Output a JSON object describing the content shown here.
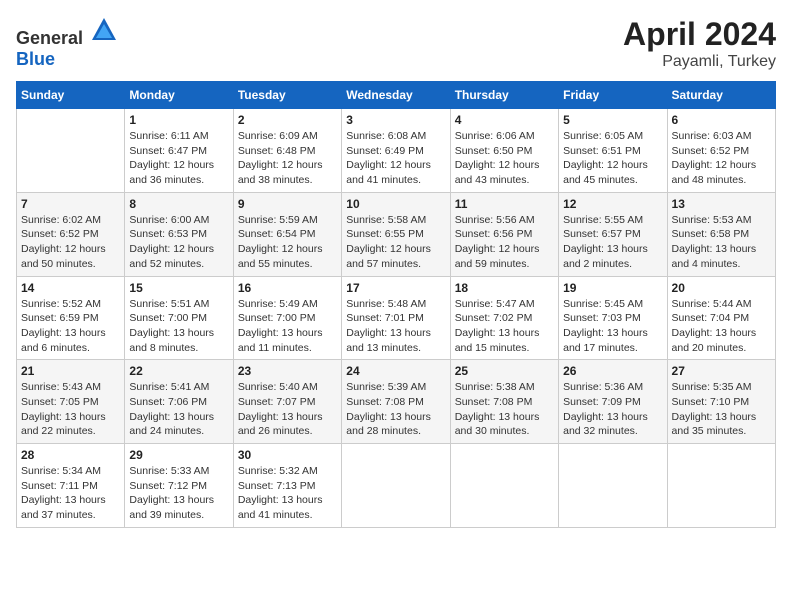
{
  "header": {
    "logo_general": "General",
    "logo_blue": "Blue",
    "title": "April 2024",
    "location": "Payamli, Turkey"
  },
  "days_of_week": [
    "Sunday",
    "Monday",
    "Tuesday",
    "Wednesday",
    "Thursday",
    "Friday",
    "Saturday"
  ],
  "weeks": [
    [
      {
        "day": "",
        "info": ""
      },
      {
        "day": "1",
        "info": "Sunrise: 6:11 AM\nSunset: 6:47 PM\nDaylight: 12 hours\nand 36 minutes."
      },
      {
        "day": "2",
        "info": "Sunrise: 6:09 AM\nSunset: 6:48 PM\nDaylight: 12 hours\nand 38 minutes."
      },
      {
        "day": "3",
        "info": "Sunrise: 6:08 AM\nSunset: 6:49 PM\nDaylight: 12 hours\nand 41 minutes."
      },
      {
        "day": "4",
        "info": "Sunrise: 6:06 AM\nSunset: 6:50 PM\nDaylight: 12 hours\nand 43 minutes."
      },
      {
        "day": "5",
        "info": "Sunrise: 6:05 AM\nSunset: 6:51 PM\nDaylight: 12 hours\nand 45 minutes."
      },
      {
        "day": "6",
        "info": "Sunrise: 6:03 AM\nSunset: 6:52 PM\nDaylight: 12 hours\nand 48 minutes."
      }
    ],
    [
      {
        "day": "7",
        "info": "Sunrise: 6:02 AM\nSunset: 6:52 PM\nDaylight: 12 hours\nand 50 minutes."
      },
      {
        "day": "8",
        "info": "Sunrise: 6:00 AM\nSunset: 6:53 PM\nDaylight: 12 hours\nand 52 minutes."
      },
      {
        "day": "9",
        "info": "Sunrise: 5:59 AM\nSunset: 6:54 PM\nDaylight: 12 hours\nand 55 minutes."
      },
      {
        "day": "10",
        "info": "Sunrise: 5:58 AM\nSunset: 6:55 PM\nDaylight: 12 hours\nand 57 minutes."
      },
      {
        "day": "11",
        "info": "Sunrise: 5:56 AM\nSunset: 6:56 PM\nDaylight: 12 hours\nand 59 minutes."
      },
      {
        "day": "12",
        "info": "Sunrise: 5:55 AM\nSunset: 6:57 PM\nDaylight: 13 hours\nand 2 minutes."
      },
      {
        "day": "13",
        "info": "Sunrise: 5:53 AM\nSunset: 6:58 PM\nDaylight: 13 hours\nand 4 minutes."
      }
    ],
    [
      {
        "day": "14",
        "info": "Sunrise: 5:52 AM\nSunset: 6:59 PM\nDaylight: 13 hours\nand 6 minutes."
      },
      {
        "day": "15",
        "info": "Sunrise: 5:51 AM\nSunset: 7:00 PM\nDaylight: 13 hours\nand 8 minutes."
      },
      {
        "day": "16",
        "info": "Sunrise: 5:49 AM\nSunset: 7:00 PM\nDaylight: 13 hours\nand 11 minutes."
      },
      {
        "day": "17",
        "info": "Sunrise: 5:48 AM\nSunset: 7:01 PM\nDaylight: 13 hours\nand 13 minutes."
      },
      {
        "day": "18",
        "info": "Sunrise: 5:47 AM\nSunset: 7:02 PM\nDaylight: 13 hours\nand 15 minutes."
      },
      {
        "day": "19",
        "info": "Sunrise: 5:45 AM\nSunset: 7:03 PM\nDaylight: 13 hours\nand 17 minutes."
      },
      {
        "day": "20",
        "info": "Sunrise: 5:44 AM\nSunset: 7:04 PM\nDaylight: 13 hours\nand 20 minutes."
      }
    ],
    [
      {
        "day": "21",
        "info": "Sunrise: 5:43 AM\nSunset: 7:05 PM\nDaylight: 13 hours\nand 22 minutes."
      },
      {
        "day": "22",
        "info": "Sunrise: 5:41 AM\nSunset: 7:06 PM\nDaylight: 13 hours\nand 24 minutes."
      },
      {
        "day": "23",
        "info": "Sunrise: 5:40 AM\nSunset: 7:07 PM\nDaylight: 13 hours\nand 26 minutes."
      },
      {
        "day": "24",
        "info": "Sunrise: 5:39 AM\nSunset: 7:08 PM\nDaylight: 13 hours\nand 28 minutes."
      },
      {
        "day": "25",
        "info": "Sunrise: 5:38 AM\nSunset: 7:08 PM\nDaylight: 13 hours\nand 30 minutes."
      },
      {
        "day": "26",
        "info": "Sunrise: 5:36 AM\nSunset: 7:09 PM\nDaylight: 13 hours\nand 32 minutes."
      },
      {
        "day": "27",
        "info": "Sunrise: 5:35 AM\nSunset: 7:10 PM\nDaylight: 13 hours\nand 35 minutes."
      }
    ],
    [
      {
        "day": "28",
        "info": "Sunrise: 5:34 AM\nSunset: 7:11 PM\nDaylight: 13 hours\nand 37 minutes."
      },
      {
        "day": "29",
        "info": "Sunrise: 5:33 AM\nSunset: 7:12 PM\nDaylight: 13 hours\nand 39 minutes."
      },
      {
        "day": "30",
        "info": "Sunrise: 5:32 AM\nSunset: 7:13 PM\nDaylight: 13 hours\nand 41 minutes."
      },
      {
        "day": "",
        "info": ""
      },
      {
        "day": "",
        "info": ""
      },
      {
        "day": "",
        "info": ""
      },
      {
        "day": "",
        "info": ""
      }
    ]
  ]
}
